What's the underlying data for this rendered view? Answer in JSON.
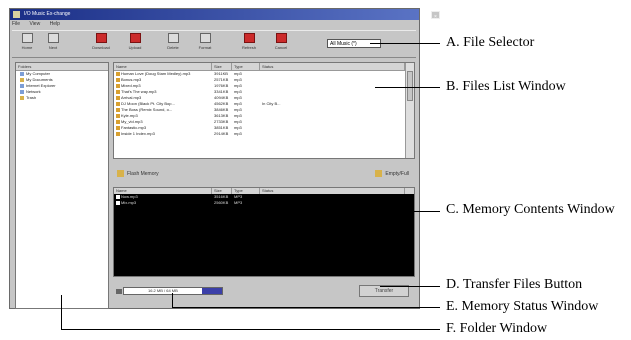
{
  "window": {
    "title": "I/O Music Ex-change",
    "menu": [
      "File",
      "View",
      "Help"
    ],
    "toolbar": [
      {
        "label": "Home",
        "icon": "home-icon"
      },
      {
        "label": "Next",
        "icon": "next-icon"
      },
      {
        "label": "Download",
        "icon": "download-icon"
      },
      {
        "label": "Upload",
        "icon": "upload-icon"
      },
      {
        "label": "Delete",
        "icon": "delete-icon"
      },
      {
        "label": "Format",
        "icon": "format-icon"
      },
      {
        "label": "Refresh",
        "icon": "refresh-icon"
      },
      {
        "label": "Cancel",
        "icon": "cancel-icon"
      }
    ],
    "file_selector_value": "All Music (*)"
  },
  "folder_window": {
    "header": "Folders",
    "items": [
      "My Computer",
      "My Documents",
      "Internet Explorer",
      "Network",
      "Trash"
    ]
  },
  "files_list": {
    "columns": [
      "Name",
      "Size",
      "Type",
      "Status"
    ],
    "rows": [
      {
        "name": "Human Love (Doug Stam Medley).mp3",
        "size": "3911KB",
        "type": "mp3",
        "status": ""
      },
      {
        "name": "Bonus.mp3",
        "size": "2571KB",
        "type": "mp3",
        "status": ""
      },
      {
        "name": "Mixed.mp3",
        "size": "1976KB",
        "type": "mp3",
        "status": ""
      },
      {
        "name": "That's The way.mp3",
        "size": "3341KB",
        "type": "mp3",
        "status": ""
      },
      {
        "name": "Arrival.mp3",
        "size": "4094KB",
        "type": "mp3",
        "status": ""
      },
      {
        "name": "DJ Moon (Black Pt. City Bop...",
        "size": "4562KB",
        "type": "mp3",
        "status": "In City B..."
      },
      {
        "name": "The Boss (Remix Sound, o...",
        "size": "3846KB",
        "type": "mp3",
        "status": ""
      },
      {
        "name": "Kyle.mp3",
        "size": "3613KB",
        "type": "mp3",
        "status": ""
      },
      {
        "name": "My_vid.mp3",
        "size": "2733KB",
        "type": "mp3",
        "status": ""
      },
      {
        "name": "Fantastic.mp3",
        "size": "3851KB",
        "type": "mp3",
        "status": ""
      },
      {
        "name": "Inside 1 Index.mp3",
        "size": "2914KB",
        "type": "mp3",
        "status": ""
      }
    ]
  },
  "memory_bar": {
    "left_label": "Flash Memory",
    "right_label": "Empty/Full"
  },
  "memory_contents": {
    "columns": [
      "Name",
      "Size",
      "Type",
      "Status"
    ],
    "rows": [
      {
        "name": "Now.mp3",
        "size": "3516KB",
        "type": "MP3",
        "status": ""
      },
      {
        "name": "Mix.mp3",
        "size": "2560KB",
        "type": "MP3",
        "status": ""
      }
    ]
  },
  "memory_status": {
    "text": "16.2 MB / 64 MB",
    "fill_fraction": 0.2
  },
  "transfer_button": "Transfer",
  "callouts": {
    "a": "A. File Selector",
    "b": "B. Files List Window",
    "c": "C. Memory Contents Window",
    "d": "D. Transfer Files Button",
    "e": "E. Memory Status Window",
    "f": "F. Folder Window"
  }
}
